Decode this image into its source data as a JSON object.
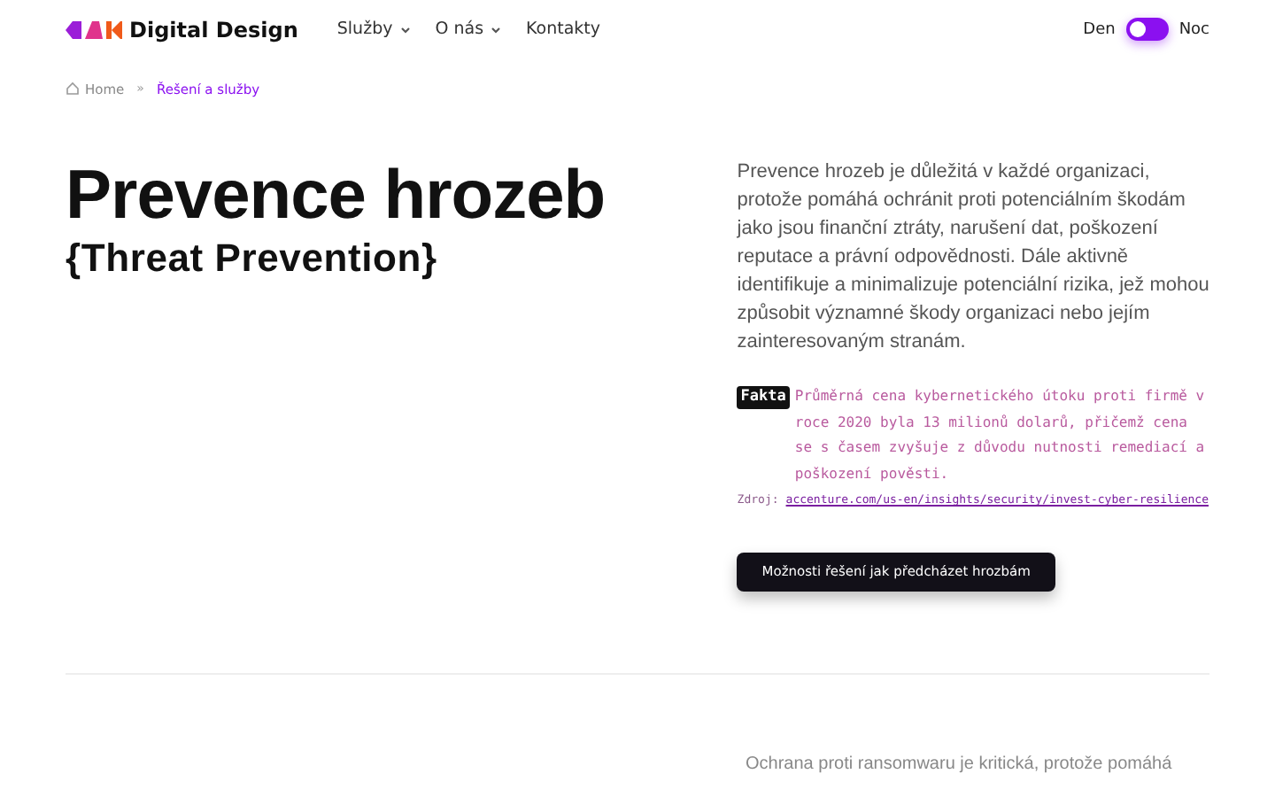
{
  "header": {
    "brand": "Digital Design",
    "nav": [
      {
        "label": "Služby",
        "dropdown": true
      },
      {
        "label": "O nás",
        "dropdown": true
      },
      {
        "label": "Kontakty",
        "dropdown": false
      }
    ],
    "theme_toggle": {
      "left_label": "Den",
      "right_label": "Noc",
      "dark_mode": false
    }
  },
  "breadcrumb": [
    {
      "label": "Home",
      "selected": false
    },
    {
      "label": "Řešení a služby",
      "selected": true
    }
  ],
  "breadcrumb_separator": "»",
  "hero": {
    "title": "Prevence hrozeb",
    "subtitle": "{Threat Prevention}",
    "description": "Prevence hrozeb je důležitá v každé organizaci, protože pomáhá ochránit proti potenciálním škodám jako jsou finanční ztráty, narušení dat, poškození reputace a právní odpovědnosti. Dále aktivně identifikuje a minimalizuje potenciální rizika, jež mohou způsobit významné škody organizaci nebo jejím zainteresovaným stranám.",
    "fact_badge": "Fakta",
    "fact_text": "Průměrná cena kybernetického útoku proti firmě v roce 2020 byla 13 milionů dolarů, přičemž cena se s časem zvyšuje z důvodu nutnosti remediací a poškození pověsti.",
    "source_label": "Zdroj:",
    "source_link": "accenture.com/us-en/insights/security/invest-cyber-resilience",
    "button": "Možnosti řešení jak předcházet hrozbám"
  },
  "next_section": {
    "description": "Ochrana proti ransomwaru je kritická, protože pomáhá"
  }
}
